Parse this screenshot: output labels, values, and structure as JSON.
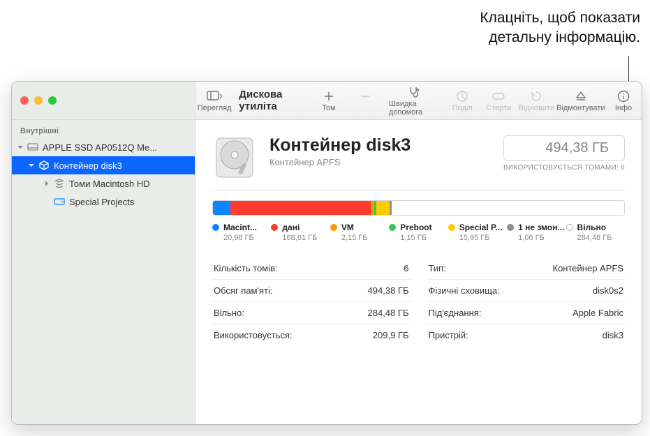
{
  "annotation": {
    "line1": "Клацніть, щоб показати",
    "line2": "детальну інформацію."
  },
  "app_title": "Дискова утиліта",
  "toolbar": {
    "view": "Перегляд",
    "volume": "Том",
    "firstaid": "Швидка допомога",
    "partition": "Поділ",
    "erase": "Стерти",
    "restore": "Відновити",
    "unmount": "Відмонтувати",
    "info": "Інфо"
  },
  "sidebar": {
    "header": "Внутрішні",
    "items": {
      "disk": "APPLE SSD AP0512Q Me...",
      "container": "Контейнер disk3",
      "volumes": "Томи Macintosh HD",
      "special": "Special Projects"
    }
  },
  "detail": {
    "title": "Контейнер disk3",
    "subtitle": "Контейнер APFS",
    "capacity": "494,38 ГБ",
    "used_by": "ВИКОРИСТОВУЄТЬСЯ ТОМАМИ: 6"
  },
  "segments": [
    {
      "label": "Macint...",
      "size": "20,98 ГБ",
      "color": "#0a84ff",
      "pct": 4.2
    },
    {
      "label": "дані",
      "size": "168,61 ГБ",
      "color": "#ff3b30",
      "pct": 34.1
    },
    {
      "label": "VM",
      "size": "2,15 ГБ",
      "color": "#ff9500",
      "pct": 0.9
    },
    {
      "label": "Preboot",
      "size": "1,15 ГБ",
      "color": "#34c759",
      "pct": 0.6
    },
    {
      "label": "Special P...",
      "size": "15,95 ГБ",
      "color": "#ffcc00",
      "pct": 3.2
    },
    {
      "label": "1 не змон...",
      "size": "1,06 ГБ",
      "color": "#8e8e93",
      "pct": 0.5
    },
    {
      "label": "Вільно",
      "size": "284,48 ГБ",
      "color": "#ffffff",
      "pct": 56.5,
      "outline": true
    }
  ],
  "info_left": [
    {
      "k": "Кількість томів:",
      "v": "6"
    },
    {
      "k": "Обсяг пам'яті:",
      "v": "494,38 ГБ"
    },
    {
      "k": "Вільно:",
      "v": "284,48 ГБ"
    },
    {
      "k": "Використовується:",
      "v": "209,9 ГБ"
    }
  ],
  "info_right": [
    {
      "k": "Тип:",
      "v": "Контейнер APFS"
    },
    {
      "k": "Фізичні сховища:",
      "v": "disk0s2"
    },
    {
      "k": "Під'єднання:",
      "v": "Apple Fabric"
    },
    {
      "k": "Пристрій:",
      "v": "disk3"
    }
  ]
}
